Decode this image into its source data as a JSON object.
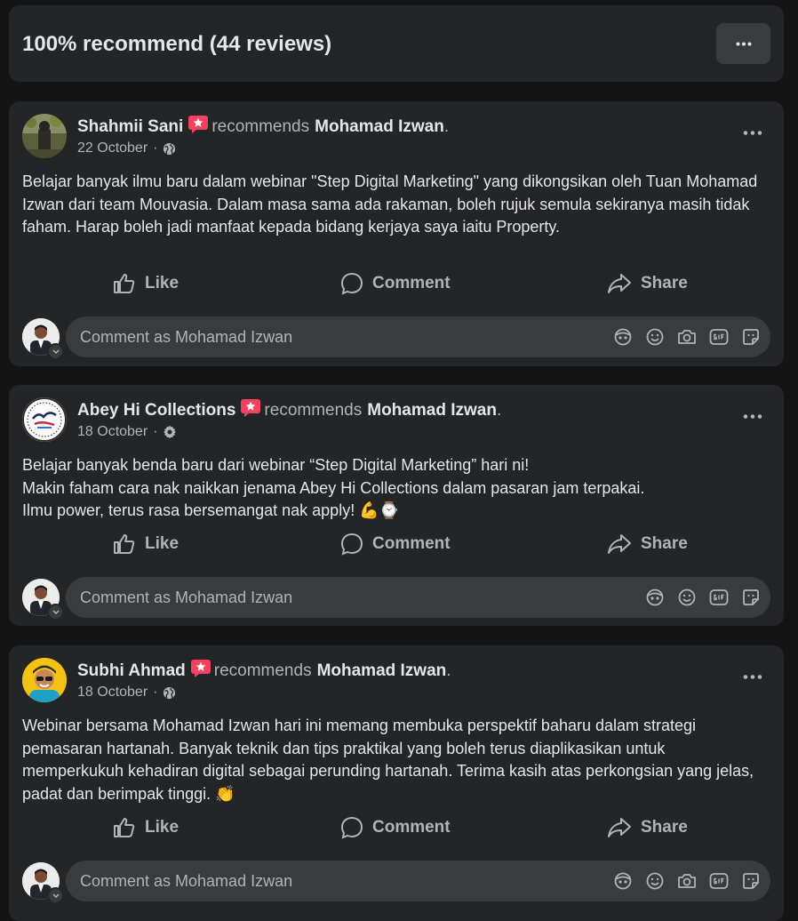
{
  "summary": {
    "title": "100% recommend (44 reviews)"
  },
  "current_user": {
    "comment_placeholder": "Comment as Mohamad Izwan"
  },
  "actions": {
    "like": "Like",
    "comment": "Comment",
    "share": "Share"
  },
  "posts": [
    {
      "author": "Shahmii Sani",
      "verb": "recommends",
      "target": "Mohamad Izwan",
      "suffix": ".",
      "date": "22 October",
      "dot": "·",
      "privacy_icon": "globe-icon",
      "text_lines": [
        "Belajar banyak ilmu baru dalam webinar \"Step Digital Marketing\" yang dikongsikan oleh Tuan Mohamad Izwan dari team Mouvasia. Dalam masa sama ada rakaman, boleh rujuk semula sekiranya masih tidak faham. Harap boleh jadi manfaat kepada bidang kerjaya saya iaitu Property."
      ]
    },
    {
      "author": "Abey Hi Collections",
      "verb": "recommends",
      "target": "Mohamad Izwan",
      "suffix": ".",
      "date": "18 October",
      "dot": "·",
      "privacy_icon": "gear-icon",
      "text_lines": [
        "Belajar banyak benda baru dari webinar “Step Digital Marketing” hari ni!",
        "Makin faham cara nak naikkan jenama Abey Hi Collections dalam pasaran jam terpakai.",
        "Ilmu power, terus rasa bersemangat nak apply! 💪⌚"
      ]
    },
    {
      "author": "Subhi Ahmad",
      "verb": "recommends",
      "target": "Mohamad Izwan",
      "suffix": ".",
      "date": "18 October",
      "dot": "·",
      "privacy_icon": "globe-icon",
      "text_lines": [
        "Webinar bersama Mohamad Izwan hari ini memang membuka perspektif baharu dalam strategi pemasaran hartanah. Banyak teknik dan tips praktikal yang boleh terus diaplikasikan untuk memperkukuh kehadiran digital sebagai perunding hartanah. Terima kasih atas perkongsian yang jelas, padat dan berimpak tinggi. 👏"
      ]
    }
  ],
  "colors": {
    "page_bg": "#141414",
    "card_bg": "#242526",
    "input_bg": "#3a3b3c",
    "primary_text": "#e4e6eb",
    "secondary_text": "#b0b3b8",
    "recommend_badge": "#f3425f"
  }
}
